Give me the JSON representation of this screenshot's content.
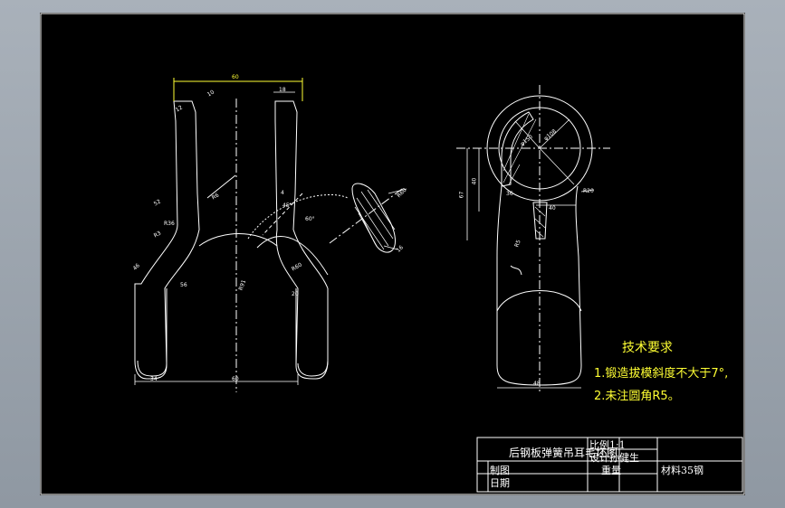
{
  "colors": {
    "background": "#000000",
    "outline": "#ffffff",
    "dimension": "#ffff33",
    "centerline": "#ffffff"
  },
  "front_view": {
    "dims": {
      "top_width": "60",
      "top_right": "18",
      "top_left": "12",
      "chamfer": "10",
      "left_r": "52",
      "left_r2": "R36",
      "mid_r": "R3",
      "center_r": "R6",
      "left_lower": "56",
      "bottom_left_r": "20",
      "arc_r": "R91",
      "right_r": "R60",
      "right_lower": "20",
      "left_outer": "46",
      "bottom_left_w": "34",
      "bottom_w": "60",
      "angle1": "45°",
      "angle2": "60°",
      "right_small": "4"
    }
  },
  "section_view": {
    "dims": {
      "r1": "R60",
      "r2": "16"
    }
  },
  "side_view": {
    "dims": {
      "phi1": "φ150",
      "phi2": "φ108",
      "h1": "67",
      "h2": "40",
      "h3": "36",
      "w1": "40",
      "r": "R20",
      "r2": "R5",
      "bottom_w": "48"
    }
  },
  "requirements": {
    "title": "技术要求",
    "items": [
      "1.锻造拔模斜度不大于7°,",
      "2.未注圆角R5。"
    ]
  },
  "title_block": {
    "part_name": "后钢板弹簧吊耳毛坯图",
    "scale_label": "比例1:1",
    "designer": "设计孙健生",
    "drawn": "制图",
    "checked": "日期",
    "weight": "重量",
    "material": "材料35钢"
  }
}
